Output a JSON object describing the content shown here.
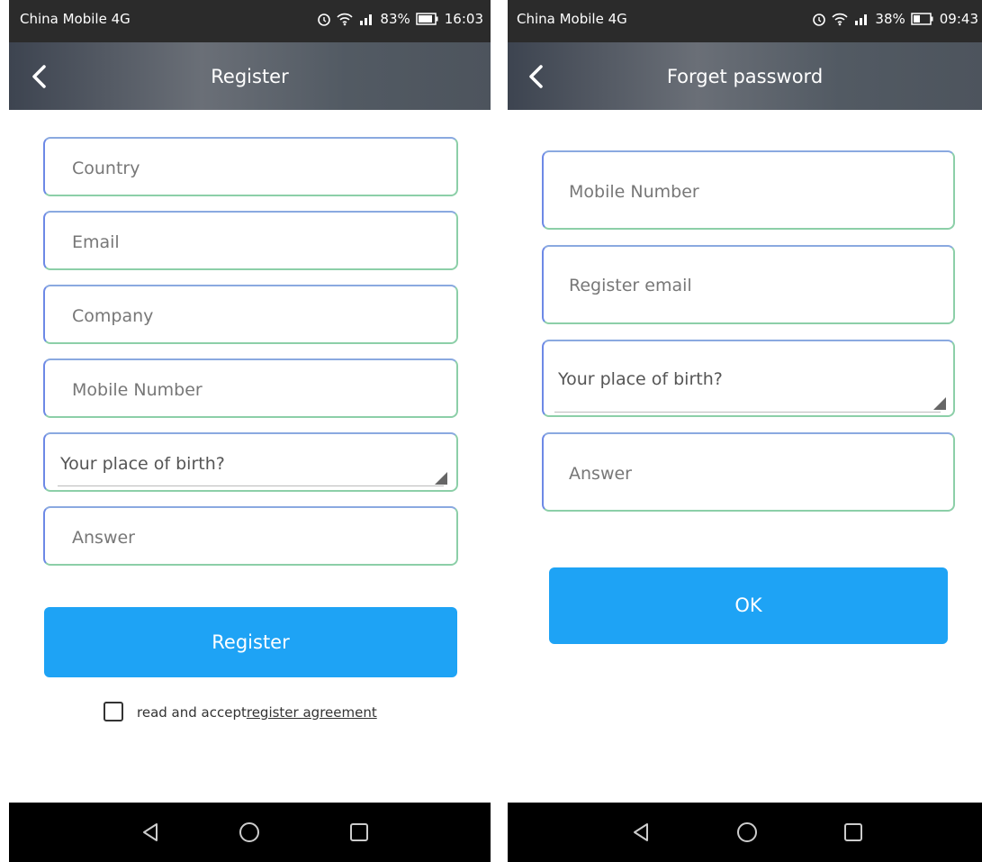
{
  "register_screen": {
    "status": {
      "carrier": "China Mobile 4G",
      "battery": "83%",
      "time": "16:03"
    },
    "title": "Register",
    "fields": {
      "country": "Country",
      "email": "Email",
      "company": "Company",
      "mobile": "Mobile Number",
      "question": "Your place of birth?",
      "answer": "Answer"
    },
    "register_button": "Register",
    "agreement_prefix": "read and accept",
    "agreement_link": "register agreement"
  },
  "forget_screen": {
    "status": {
      "carrier": "China Mobile 4G",
      "battery": "38%",
      "time": "09:43"
    },
    "title": "Forget password",
    "fields": {
      "mobile": "Mobile Number",
      "email": "Register email",
      "question": "Your place of birth?",
      "answer": "Answer"
    },
    "ok_button": "OK"
  },
  "colors": {
    "accent": "#1ea3f5",
    "field_border_green": "#8ccfa8",
    "field_border_blue": "#6d89e6"
  },
  "icons": [
    "back-icon",
    "alarm-icon",
    "wifi-icon",
    "signal-icon",
    "battery-icon",
    "nav-back-icon",
    "nav-home-icon",
    "nav-recents-icon",
    "dropdown-arrow-icon",
    "checkbox-icon"
  ]
}
